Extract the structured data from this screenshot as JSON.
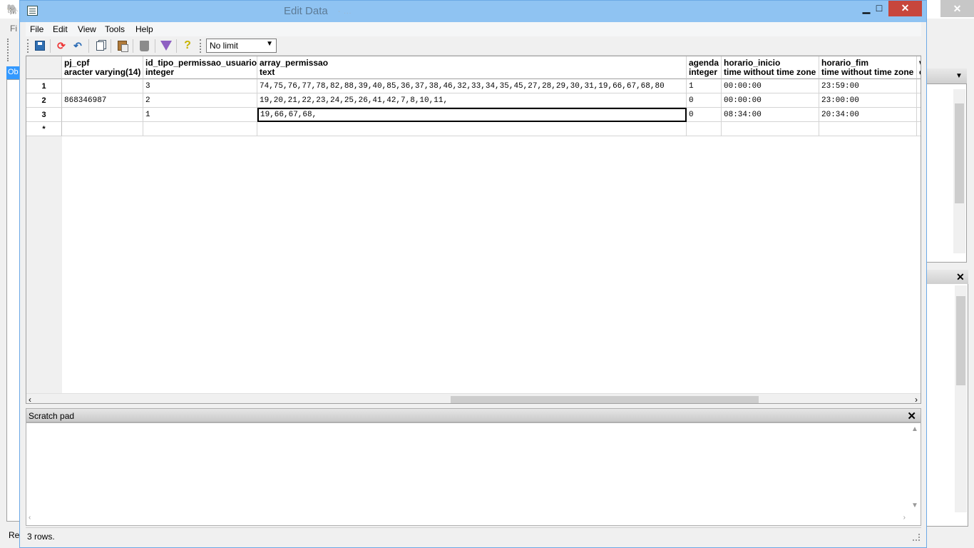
{
  "background_app": {
    "menu_stub": "Fi",
    "object_tab_stub": "Ob",
    "status_stub": "Re"
  },
  "dialog": {
    "title": "Edit Data",
    "title_extra": "- ..."
  },
  "menu": {
    "file": "File",
    "edit": "Edit",
    "view": "View",
    "tools": "Tools",
    "help": "Help"
  },
  "toolbar": {
    "limit_value": "No limit",
    "limit_options": [
      "No limit"
    ]
  },
  "grid": {
    "columns": [
      {
        "name": "pj_cpf",
        "type": "aracter varying(14)"
      },
      {
        "name": "id_tipo_permissao_usuario",
        "type": "integer"
      },
      {
        "name": "array_permissao",
        "type": "text"
      },
      {
        "name": "agenda",
        "type": "integer"
      },
      {
        "name": "horario_inicio",
        "type": "time without time zone"
      },
      {
        "name": "horario_fim",
        "type": "time without time zone"
      },
      {
        "name": "v",
        "type": "c"
      }
    ],
    "rows": [
      {
        "num": "1",
        "cells": [
          "",
          "3",
          "74,75,76,77,78,82,88,39,40,85,36,37,38,46,32,33,34,35,45,27,28,29,30,31,19,66,67,68,80",
          "1",
          "00:00:00",
          "23:59:00",
          ""
        ]
      },
      {
        "num": "2",
        "cells": [
          "868346987",
          "2",
          "19,20,21,22,23,24,25,26,41,42,7,8,10,11,",
          "0",
          "00:00:00",
          "23:00:00",
          ""
        ]
      },
      {
        "num": "3",
        "cells": [
          "",
          "1",
          "19,66,67,68,",
          "0",
          "08:34:00",
          "20:34:00",
          ""
        ]
      },
      {
        "num": "*",
        "cells": [
          "",
          "",
          "",
          "",
          "",
          "",
          ""
        ]
      }
    ]
  },
  "scratch_pad": {
    "title": "Scratch pad",
    "content": ""
  },
  "status": {
    "text": "3 rows."
  }
}
